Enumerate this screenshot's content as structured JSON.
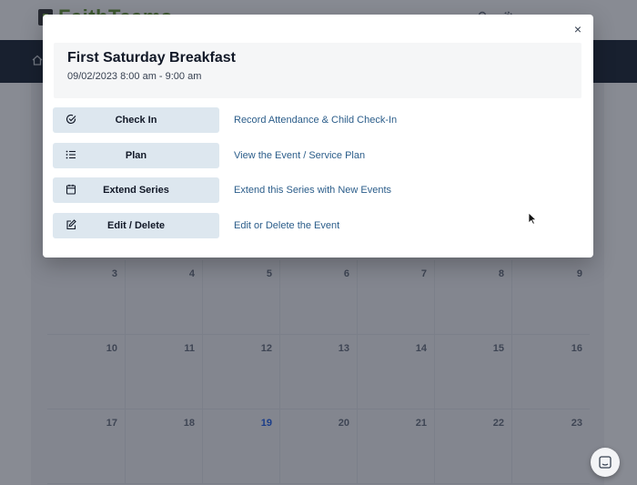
{
  "app": {
    "logo_text": "FaithTeams",
    "calendar": {
      "weeks": [
        [
          "3",
          "4",
          "5",
          "6",
          "7",
          "8",
          "9"
        ],
        [
          "10",
          "11",
          "12",
          "13",
          "14",
          "15",
          "16"
        ],
        [
          "17",
          "18",
          "19",
          "20",
          "21",
          "22",
          "23"
        ]
      ],
      "today": "19",
      "today_color": "#2563eb"
    }
  },
  "modal": {
    "close_icon": "×",
    "event": {
      "title": "First Saturday Breakfast",
      "datetime": "09/02/2023 8:00 am - 9:00 am"
    },
    "actions": [
      {
        "icon": "check-circle-icon",
        "label": "Check In",
        "description": "Record Attendance & Child Check-In"
      },
      {
        "icon": "list-icon",
        "label": "Plan",
        "description": "View the Event / Service Plan"
      },
      {
        "icon": "calendar-icon",
        "label": "Extend Series",
        "description": "Extend this Series with New Events"
      },
      {
        "icon": "edit-icon",
        "label": "Edit / Delete",
        "description": "Edit or Delete the Event"
      }
    ]
  },
  "colors": {
    "button_bg": "#dde7ef",
    "link": "#2b5d8a",
    "overlay": "rgba(17,24,39,0.5)"
  }
}
